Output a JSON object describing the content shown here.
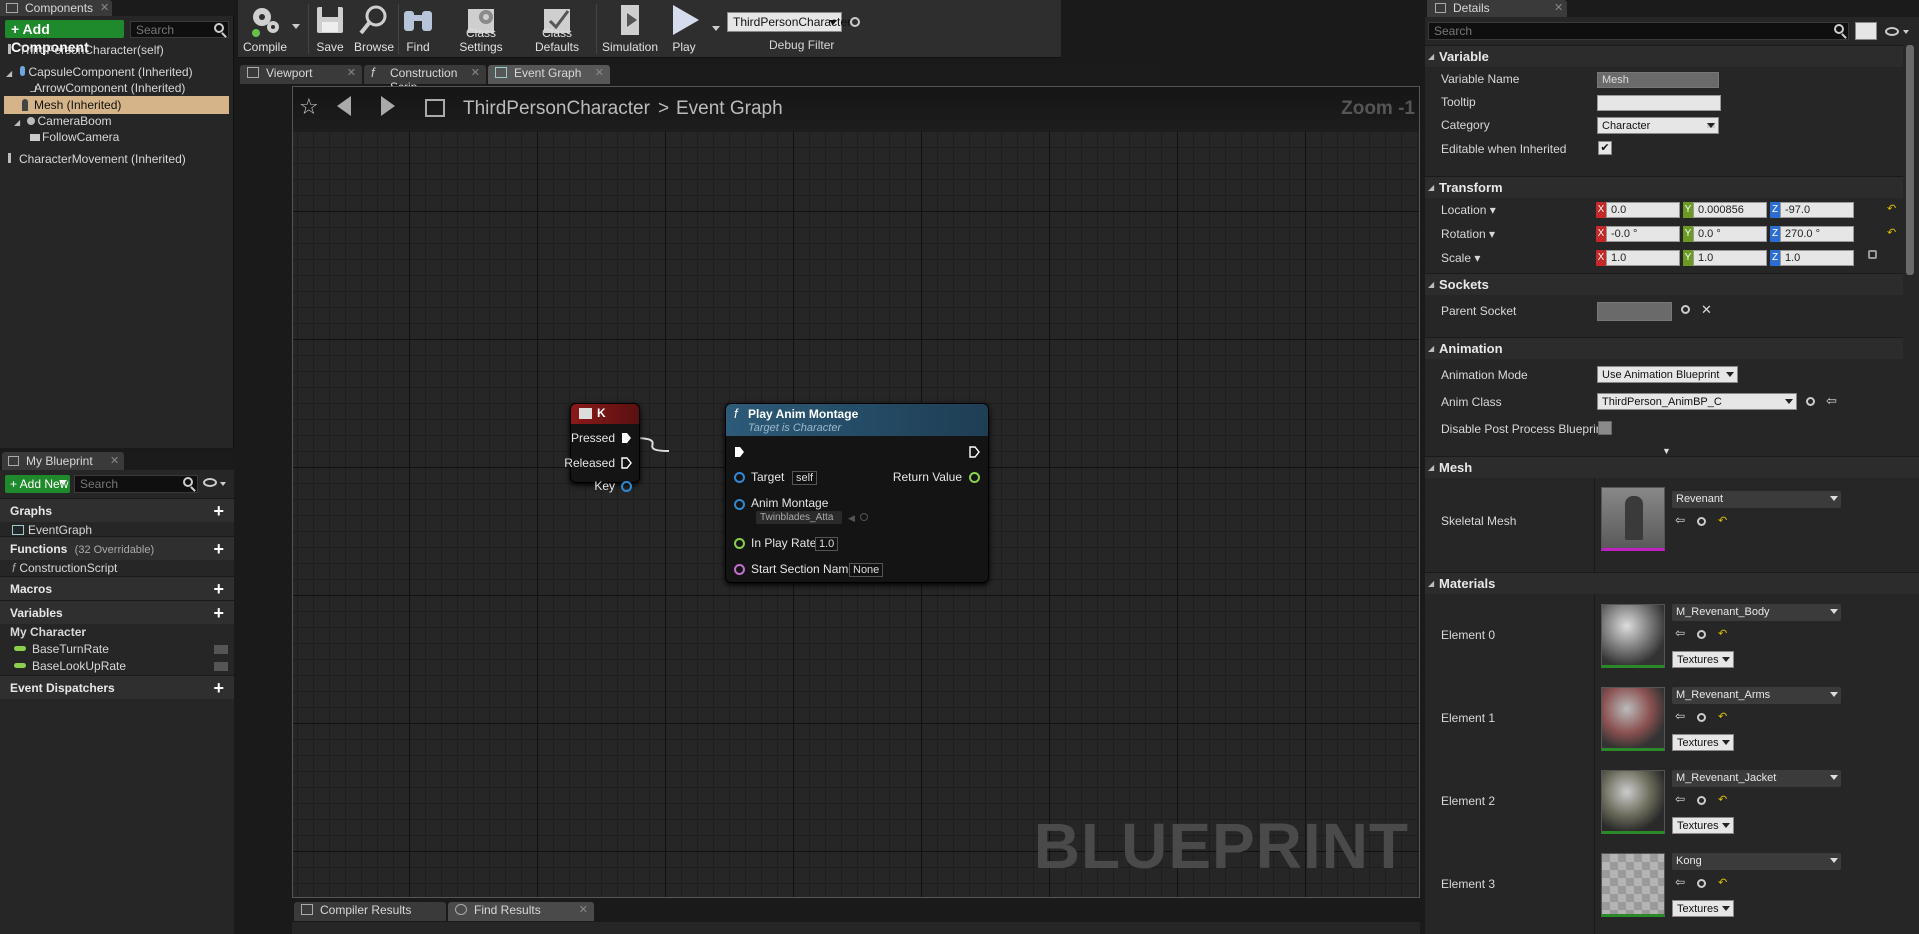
{
  "components": {
    "tab_title": "Components",
    "add_button": "+ Add Component",
    "search_placeholder": "Search",
    "items": [
      "ThirdPersonCharacter(self)",
      "CapsuleComponent (Inherited)",
      "ArrowComponent (Inherited)",
      "Mesh (Inherited)",
      "CameraBoom",
      "FollowCamera",
      "CharacterMovement (Inherited)"
    ]
  },
  "toolbar": {
    "compile": "Compile",
    "save": "Save",
    "browse": "Browse",
    "find": "Find",
    "class_settings": "Class Settings",
    "class_defaults": "Class Defaults",
    "simulation": "Simulation",
    "play": "Play",
    "debug_object": "ThirdPersonCharacter",
    "debug_filter": "Debug Filter"
  },
  "graph_tabs": [
    "Viewport",
    "Construction Scrip",
    "Event Graph"
  ],
  "breadcrumb": {
    "root": "ThirdPersonCharacter",
    "separator": ">",
    "current": "Event Graph",
    "zoom": "Zoom -1"
  },
  "watermark": "BLUEPRINT",
  "key_node": {
    "title": "K",
    "pins": [
      "Pressed",
      "Released",
      "Key"
    ]
  },
  "anim_node": {
    "title": "Play Anim Montage",
    "subtitle": "Target is Character",
    "target_label": "Target",
    "target_value": "self",
    "return_label": "Return Value",
    "montage_label": "Anim Montage",
    "montage_value": "Twinblades_Atta",
    "rate_label": "In Play Rate",
    "rate_value": "1.0",
    "section_label": "Start Section Name",
    "section_value": "None"
  },
  "bottom_tabs": [
    "Compiler Results",
    "Find Results"
  ],
  "my_blueprint": {
    "tab_title": "My Blueprint",
    "add_new": "+ Add New",
    "search_placeholder": "Search",
    "graphs": "Graphs",
    "event_graph": "EventGraph",
    "functions": "Functions",
    "functions_count": "(32 Overridable)",
    "construction_script": "ConstructionScript",
    "macros": "Macros",
    "variables": "Variables",
    "my_character": "My Character",
    "vars": [
      "BaseTurnRate",
      "BaseLookUpRate"
    ],
    "event_dispatchers": "Event Dispatchers"
  },
  "details": {
    "tab_title": "Details",
    "search_placeholder": "Search",
    "variable": {
      "header": "Variable",
      "name_label": "Variable Name",
      "name_value": "Mesh",
      "tooltip_label": "Tooltip",
      "tooltip_value": "",
      "category_label": "Category",
      "category_value": "Character",
      "editable_label": "Editable when Inherited"
    },
    "transform": {
      "header": "Transform",
      "location_label": "Location",
      "rotation_label": "Rotation",
      "scale_label": "Scale",
      "location": [
        "0.0",
        "0.000856",
        "-97.0"
      ],
      "rotation": [
        "-0.0 °",
        "0.0 °",
        "270.0 °"
      ],
      "scale": [
        "1.0",
        "1.0",
        "1.0"
      ],
      "axes": [
        "X",
        "Y",
        "Z"
      ]
    },
    "sockets": {
      "header": "Sockets",
      "parent_label": "Parent Socket"
    },
    "animation": {
      "header": "Animation",
      "mode_label": "Animation Mode",
      "mode_value": "Use Animation Blueprint",
      "class_label": "Anim Class",
      "class_value": "ThirdPerson_AnimBP_C",
      "disable_pp_label": "Disable Post Process Blueprin"
    },
    "mesh": {
      "header": "Mesh",
      "skeletal_label": "Skeletal Mesh",
      "skeletal_value": "Revenant"
    },
    "materials": {
      "header": "Materials",
      "textures_label": "Textures",
      "elements": [
        {
          "label": "Element 0",
          "value": "M_Revenant_Body"
        },
        {
          "label": "Element 1",
          "value": "M_Revenant_Arms"
        },
        {
          "label": "Element 2",
          "value": "M_Revenant_Jacket"
        },
        {
          "label": "Element 3",
          "value": "Kong"
        }
      ]
    }
  },
  "colors": {
    "accent_green": "#1f8a2b",
    "selected_row": "#d6b48a",
    "node_red": "#8b1a1a",
    "node_blue": "#2c5a78",
    "axis_x": "#c42828",
    "axis_y": "#6a9a22",
    "axis_z": "#2a6ed2"
  }
}
